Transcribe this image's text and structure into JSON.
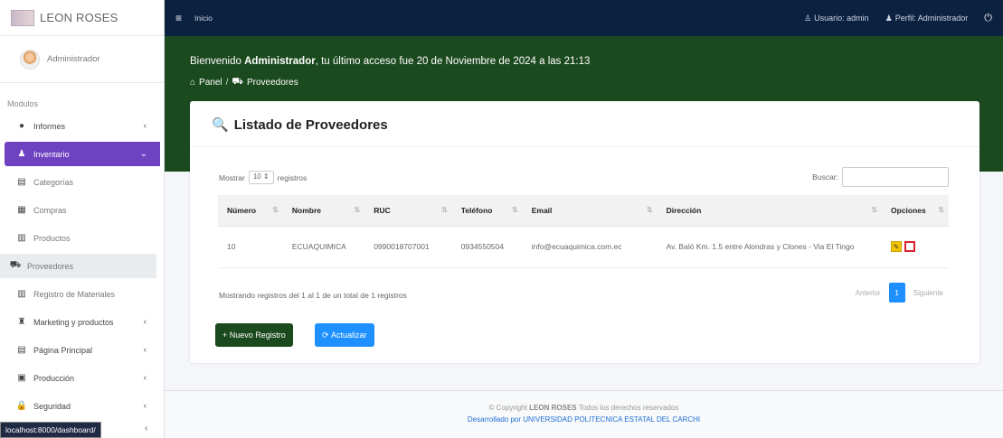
{
  "sidebar": {
    "brand": "LEON ROSES",
    "user": "Administrador",
    "header": "Modulos",
    "items": [
      {
        "label": "Informes",
        "icon": "globe-icon",
        "glyph": "●",
        "chevron": "‹"
      },
      {
        "label": "Inventario",
        "icon": "inventory-icon",
        "glyph": "♟",
        "chevron": "⌄"
      },
      {
        "label": "Categorías",
        "icon": "category-icon",
        "glyph": "▤",
        "chevron": ""
      },
      {
        "label": "Compras",
        "icon": "purchases-icon",
        "glyph": "▦",
        "chevron": ""
      },
      {
        "label": "Productos",
        "icon": "products-icon",
        "glyph": "▥",
        "chevron": ""
      },
      {
        "label": "Proveedores",
        "icon": "truck-icon",
        "glyph": "⛟",
        "chevron": ""
      },
      {
        "label": "Registro de Materiales",
        "icon": "materials-icon",
        "glyph": "▥",
        "chevron": ""
      },
      {
        "label": "Marketing y productos",
        "icon": "marketing-icon",
        "glyph": "♜",
        "chevron": "‹"
      },
      {
        "label": "Página Principal",
        "icon": "page-icon",
        "glyph": "▤",
        "chevron": "‹"
      },
      {
        "label": "Producción",
        "icon": "production-icon",
        "glyph": "▣",
        "chevron": "‹"
      },
      {
        "label": "Seguridad",
        "icon": "lock-icon",
        "glyph": "🔒",
        "chevron": "‹"
      }
    ],
    "status_url": "localhost:8000/dashboard/",
    "status_chevron": "‹"
  },
  "topbar": {
    "home": "Inicio",
    "user": "Usuario: admin",
    "profile": "Perfil: Administrador"
  },
  "header": {
    "welcome_prefix": "Bienvenido",
    "welcome_name": "Administrador",
    "welcome_suffix": ", tu último acceso fue 20 de Noviembre de 2024 a las 21:13",
    "crumb_panel": "Panel",
    "crumb_current": "Proveedores"
  },
  "card": {
    "title": "Listado de Proveedores",
    "show_label": "Mostrar",
    "show_value": "10",
    "records_label": "registros",
    "search_label": "Buscar:",
    "columns": [
      "Número",
      "Nombre",
      "RUC",
      "Teléfono",
      "Email",
      "Dirección",
      "Opciones"
    ],
    "rows": [
      {
        "numero": "10",
        "nombre": "ECUAQUIMICA",
        "ruc": "0990018707001",
        "telefono": "0934550504",
        "email": "info@ecuaquimica.com.ec",
        "direccion": "Av. Baló Km. 1.5 entre Alondras y Clones - Via El Tingo"
      }
    ],
    "info": "Mostrando registros del 1 al 1 de un total de 1 registros",
    "prev": "Anterior",
    "page": "1",
    "next": "Siguiente"
  },
  "buttons": {
    "new": "+ Nuevo Registro",
    "refresh": "Actualizar"
  },
  "footer": {
    "copyright": "© Copyright",
    "brand": "LEON ROSES",
    "rights": "Todos los derechos reservados",
    "developed": "Desarrollado por UNIVERSIDAD POLITECNICA ESTATAL DEL CARCHI"
  },
  "colors": {
    "accent": "#6f42c1",
    "topbar": "#0b2140",
    "header": "#1c4a1f",
    "primary": "#1e90ff"
  }
}
